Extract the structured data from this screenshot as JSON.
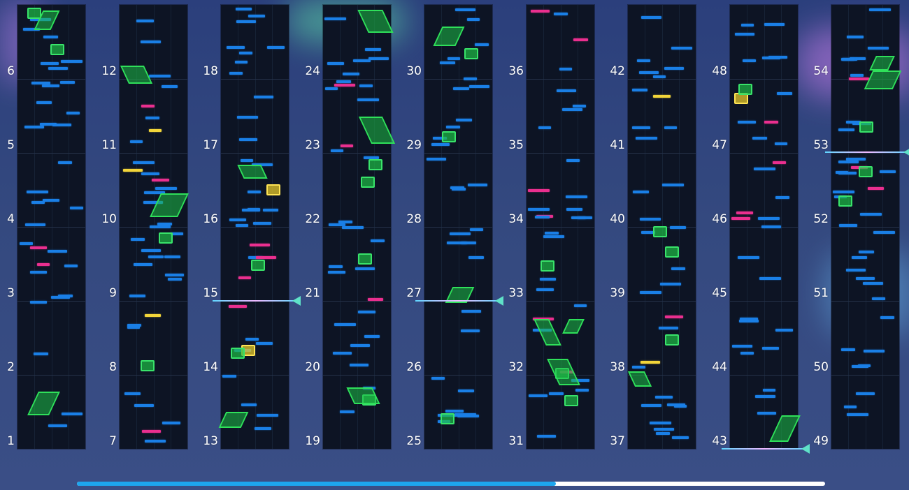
{
  "editor": {
    "measure_numbers": [
      "1",
      "2",
      "3",
      "4",
      "5",
      "6",
      "7",
      "8",
      "9",
      "10",
      "11",
      "12",
      "13",
      "14",
      "15",
      "16",
      "17",
      "18",
      "19",
      "20",
      "21",
      "22",
      "23",
      "24",
      "25",
      "26",
      "27",
      "28",
      "29",
      "30",
      "31",
      "32",
      "33",
      "34",
      "35",
      "36",
      "37",
      "38",
      "39",
      "40",
      "41",
      "42",
      "43",
      "44",
      "45",
      "46",
      "47",
      "48",
      "49",
      "50",
      "51",
      "52",
      "53",
      "54"
    ],
    "note_colors": {
      "tap": "#1a7fe6",
      "flick": "#ea2f8f",
      "critical": "#f2d53a",
      "slide": "#2fe05a"
    },
    "scrub_progress": 0.64
  }
}
